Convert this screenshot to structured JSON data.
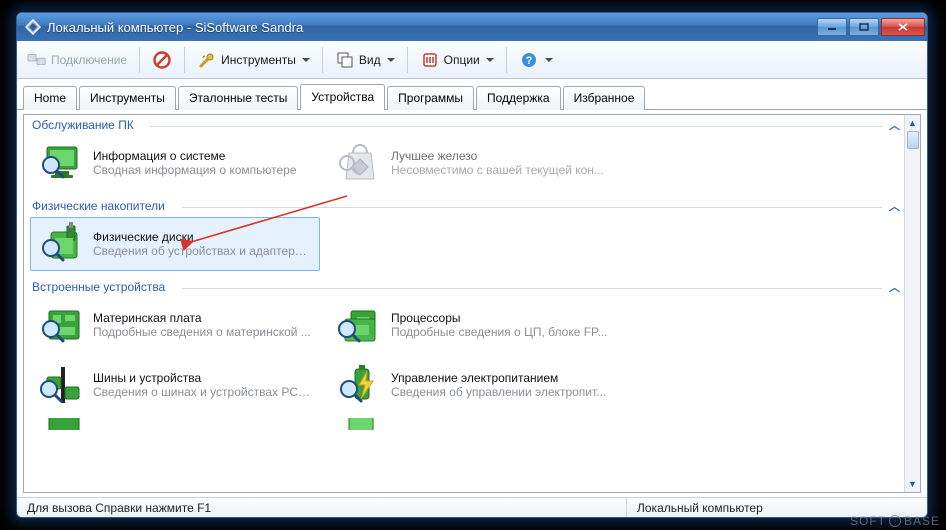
{
  "title": "Локальный компьютер - SiSoftware Sandra",
  "toolbar": {
    "connection": "Подключение",
    "tools": "Инструменты",
    "view": "Вид",
    "options": "Опции"
  },
  "tabs": [
    "Home",
    "Инструменты",
    "Эталонные тесты",
    "Устройства",
    "Программы",
    "Поддержка",
    "Избранное"
  ],
  "activeTab": 3,
  "groups": {
    "g1": {
      "header": "Обслуживание ПК"
    },
    "g2": {
      "header": "Физические накопители"
    },
    "g3": {
      "header": "Встроенные устройства"
    }
  },
  "items": {
    "sysinfo": {
      "title": "Информация о системе",
      "desc": "Сводная информация о компьютере"
    },
    "besthw": {
      "title": "Лучшее железо",
      "desc": "Несовместимо с вашей текущей кон..."
    },
    "physdisk": {
      "title": "Физические диски",
      "desc": "Сведения об устройствах и адаптерах ..."
    },
    "mb": {
      "title": "Материнская плата",
      "desc": "Подробные сведения о материнской ..."
    },
    "cpu": {
      "title": "Процессоры",
      "desc": "Подробные сведения о ЦП, блоке FP..."
    },
    "bus": {
      "title": "Шины и устройства",
      "desc": "Сведения о шинах и устройствах PCI(..."
    },
    "power": {
      "title": "Управление электропитанием",
      "desc": "Сведения об управлении электропит..."
    }
  },
  "status": {
    "help": "Для вызова Справки нажмите F1",
    "target": "Локальный компьютер"
  },
  "watermark": {
    "a": "SOFT",
    "b": "BASE"
  }
}
